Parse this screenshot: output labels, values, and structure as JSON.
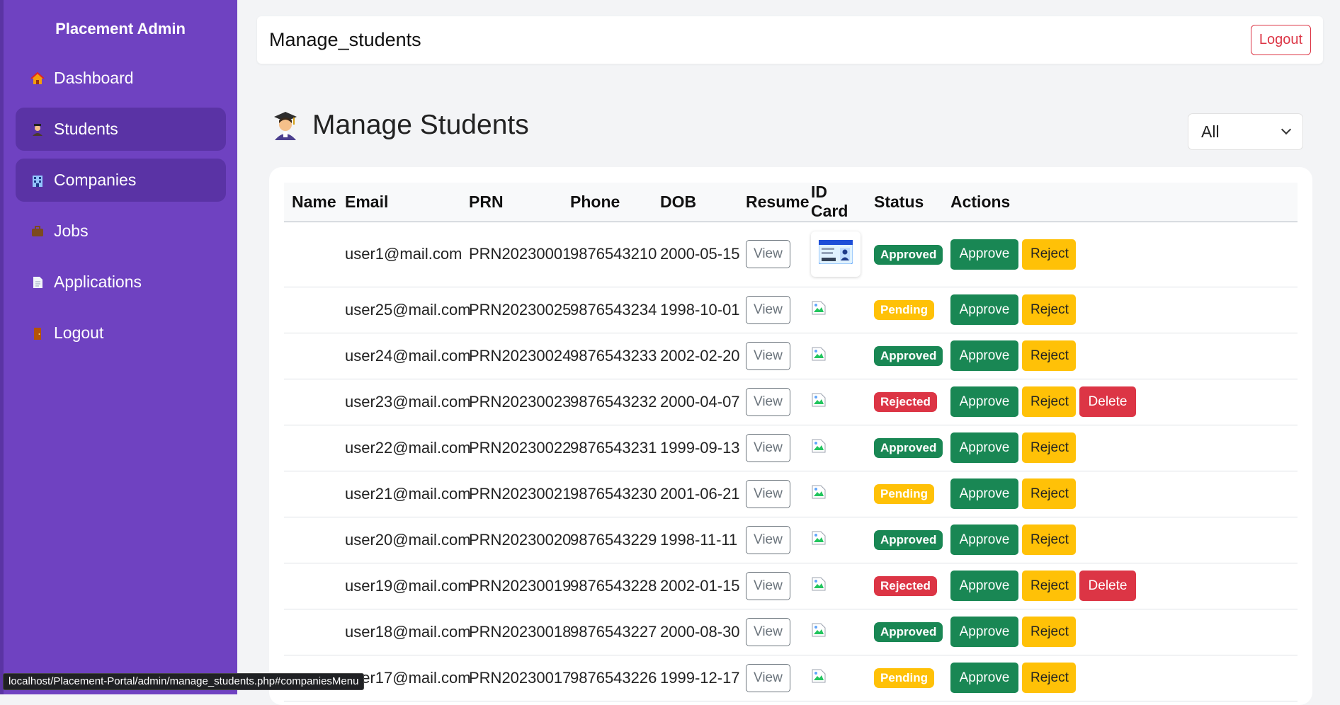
{
  "sidebar": {
    "brand": "Placement Admin",
    "items": [
      {
        "label": "Dashboard",
        "icon": "house-icon"
      },
      {
        "label": "Students",
        "icon": "student-icon"
      },
      {
        "label": "Companies",
        "icon": "building-icon"
      },
      {
        "label": "Jobs",
        "icon": "briefcase-icon"
      },
      {
        "label": "Applications",
        "icon": "document-icon"
      },
      {
        "label": "Logout",
        "icon": "door-icon"
      }
    ],
    "active": "Students",
    "hovered": "Companies",
    "accent": "#6f42c1"
  },
  "topbar": {
    "title": "Manage_students",
    "logout_label": "Logout"
  },
  "page": {
    "title": "Manage Students",
    "filter_value": "All"
  },
  "table": {
    "headers": [
      "Name",
      "Email",
      "PRN",
      "Phone",
      "DOB",
      "Resume",
      "ID Card",
      "Status",
      "Actions"
    ],
    "view_label": "View",
    "approve_label": "Approve",
    "reject_label": "Reject",
    "delete_label": "Delete",
    "rows": [
      {
        "name": "",
        "email": "user1@mail.com",
        "prn": "PRN20230001",
        "phone": "9876543210",
        "dob": "2000-05-15",
        "status": "Approved",
        "id_card": "image"
      },
      {
        "name": "",
        "email": "user25@mail.com",
        "prn": "PRN20230025",
        "phone": "9876543234",
        "dob": "1998-10-01",
        "status": "Pending",
        "id_card": "broken"
      },
      {
        "name": "",
        "email": "user24@mail.com",
        "prn": "PRN20230024",
        "phone": "9876543233",
        "dob": "2002-02-20",
        "status": "Approved",
        "id_card": "broken"
      },
      {
        "name": "",
        "email": "user23@mail.com",
        "prn": "PRN20230023",
        "phone": "9876543232",
        "dob": "2000-04-07",
        "status": "Rejected",
        "id_card": "broken"
      },
      {
        "name": "",
        "email": "user22@mail.com",
        "prn": "PRN20230022",
        "phone": "9876543231",
        "dob": "1999-09-13",
        "status": "Approved",
        "id_card": "broken"
      },
      {
        "name": "",
        "email": "user21@mail.com",
        "prn": "PRN20230021",
        "phone": "9876543230",
        "dob": "2001-06-21",
        "status": "Pending",
        "id_card": "broken"
      },
      {
        "name": "",
        "email": "user20@mail.com",
        "prn": "PRN20230020",
        "phone": "9876543229",
        "dob": "1998-11-11",
        "status": "Approved",
        "id_card": "broken"
      },
      {
        "name": "",
        "email": "user19@mail.com",
        "prn": "PRN20230019",
        "phone": "9876543228",
        "dob": "2002-01-15",
        "status": "Rejected",
        "id_card": "broken"
      },
      {
        "name": "",
        "email": "user18@mail.com",
        "prn": "PRN20230018",
        "phone": "9876543227",
        "dob": "2000-08-30",
        "status": "Approved",
        "id_card": "broken"
      },
      {
        "name": "",
        "email": "user17@mail.com",
        "prn": "PRN20230017",
        "phone": "9876543226",
        "dob": "1999-12-17",
        "status": "Pending",
        "id_card": "broken"
      }
    ]
  },
  "statusbar": {
    "url": "localhost/Placement-Portal/admin/manage_students.php#companiesMenu"
  },
  "colors": {
    "approved": "#198754",
    "pending": "#ffc107",
    "rejected": "#dc3545"
  }
}
